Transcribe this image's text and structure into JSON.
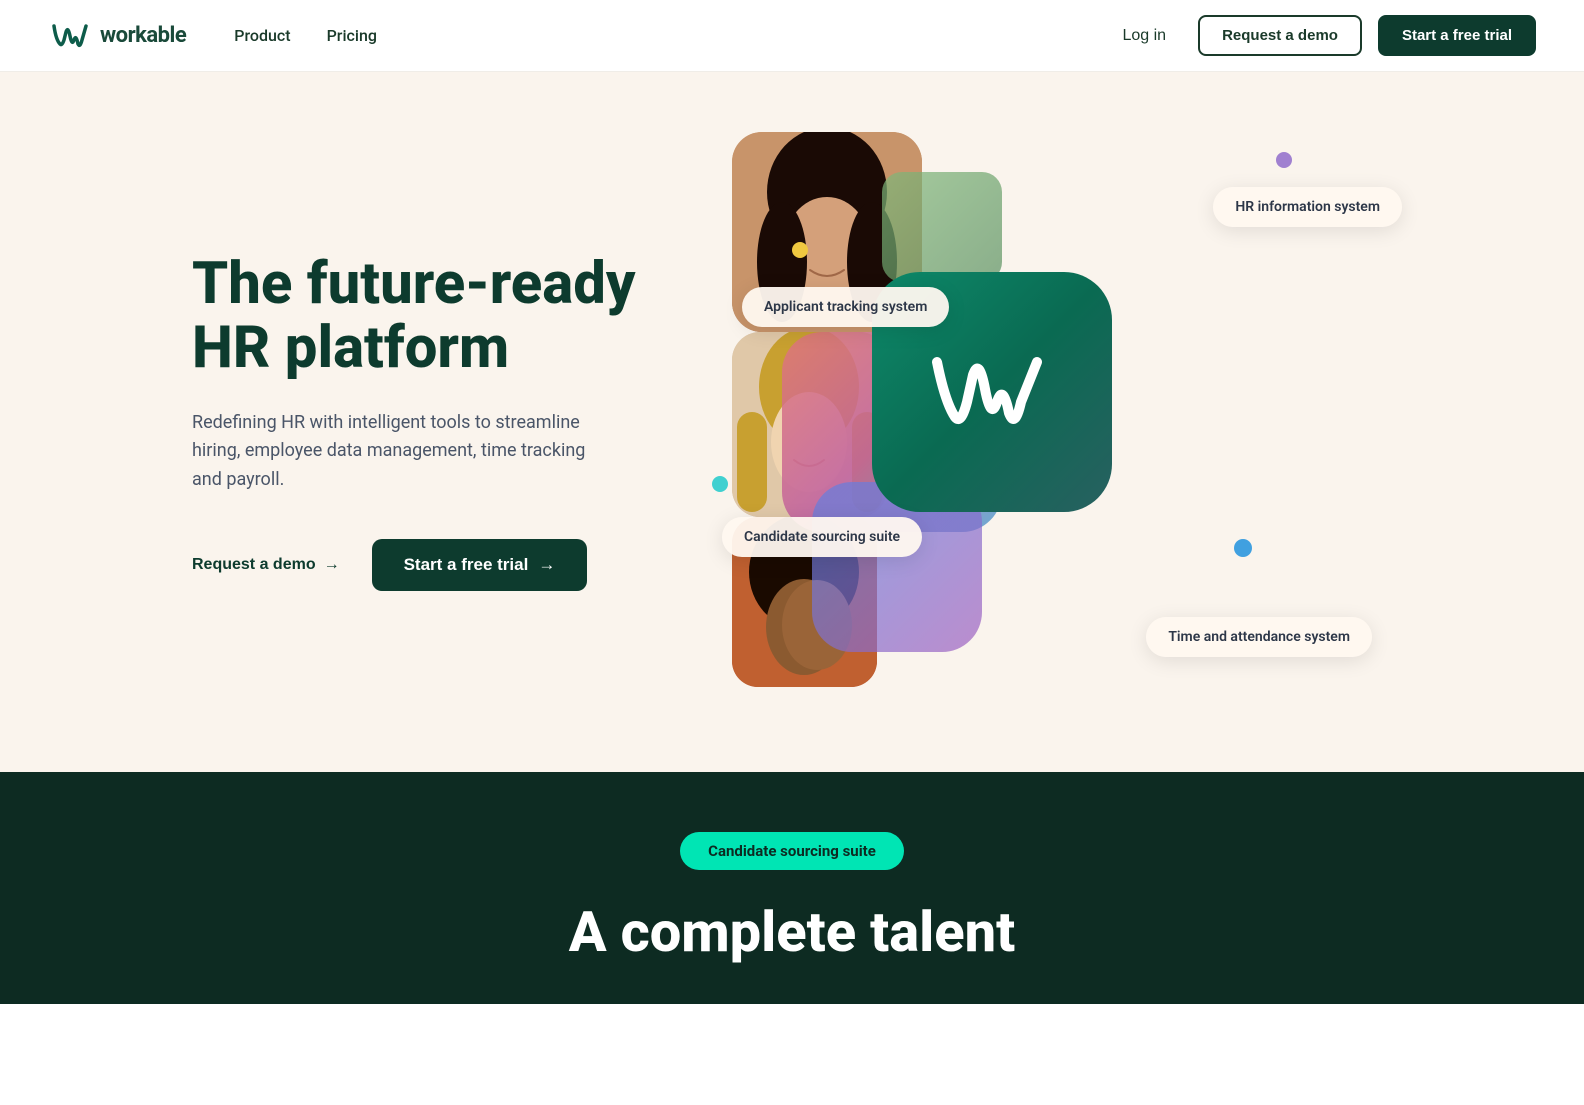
{
  "nav": {
    "logo_text": "workable",
    "links": [
      {
        "label": "Product",
        "id": "product"
      },
      {
        "label": "Pricing",
        "id": "pricing"
      }
    ],
    "login_label": "Log in",
    "demo_label": "Request a demo",
    "trial_label": "Start a free trial"
  },
  "hero": {
    "title_line1": "The future-ready",
    "title_line2": "HR platform",
    "subtitle": "Redefining HR with intelligent tools to streamline hiring, employee data management, time tracking and payroll.",
    "request_demo_label": "Request a demo",
    "trial_label": "Start a free trial"
  },
  "pills": {
    "hr_info": "HR information system",
    "ats": "Applicant tracking system",
    "candidate": "Candidate sourcing suite",
    "time": "Time and attendance system"
  },
  "dark_section": {
    "badge_label": "Candidate sourcing suite",
    "title_line1": "A complete talent"
  }
}
